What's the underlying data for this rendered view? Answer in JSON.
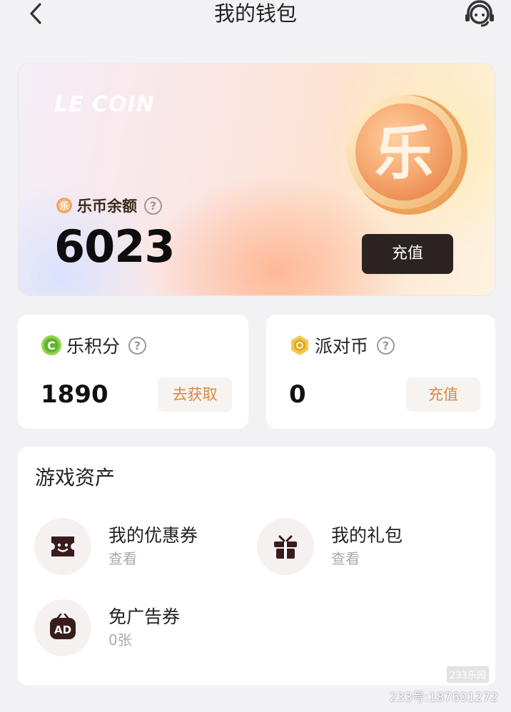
{
  "header": {
    "title": "我的钱包"
  },
  "coin_card": {
    "watermark": "LE COIN",
    "coin_glyph": "乐",
    "label": "乐币余额",
    "value": "6023",
    "recharge_label": "充值"
  },
  "points_card": {
    "label": "乐积分",
    "value": "1890",
    "action_label": "去获取",
    "icon_glyph": "C"
  },
  "party_card": {
    "label": "派对币",
    "value": "0",
    "action_label": "充值"
  },
  "assets": {
    "title": "游戏资产",
    "items": [
      {
        "name": "我的优惠券",
        "sub": "查看",
        "icon": "coupon-icon"
      },
      {
        "name": "我的礼包",
        "sub": "查看",
        "icon": "gift-icon"
      },
      {
        "name": "免广告券",
        "sub": "0张",
        "icon": "ad-free-icon",
        "icon_text": "AD"
      }
    ]
  },
  "watermark": {
    "text": "233号:187601272",
    "logo": "233乐园"
  },
  "colors": {
    "accent": "#d8893f",
    "dark_button": "#2b2321",
    "icon_dark": "#3a1c1c"
  },
  "help_glyph": "?"
}
